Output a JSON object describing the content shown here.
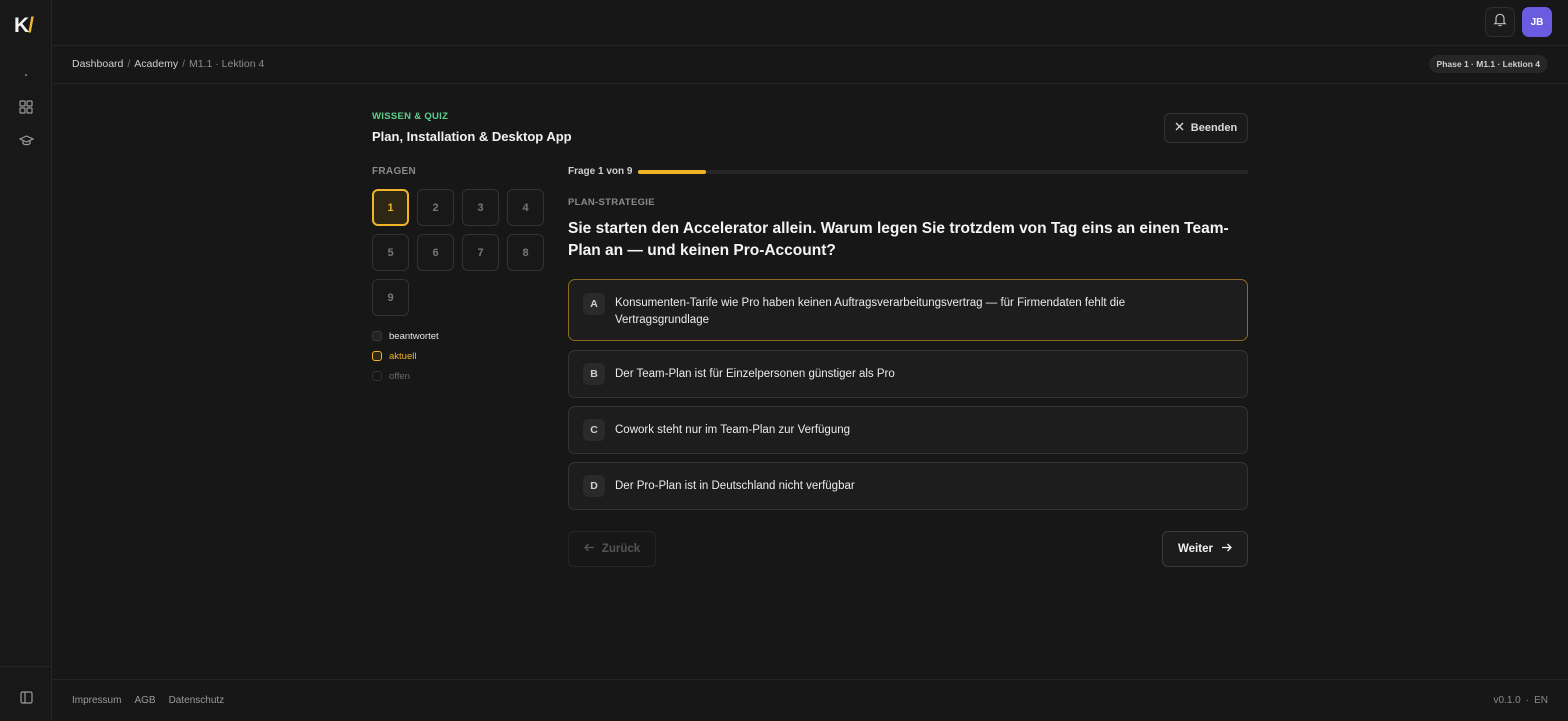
{
  "brand": {
    "logo_k": "K",
    "logo_slash": "/"
  },
  "sidebar": {
    "items": [
      {
        "icon": "dashboard-grid-icon"
      },
      {
        "icon": "graduation-cap-icon"
      }
    ],
    "bottom_icon": "sidebar-toggle-icon"
  },
  "header": {
    "avatar_initials": "JB",
    "notification_icon": "bell-icon"
  },
  "breadcrumb": {
    "items": [
      "Dashboard",
      "Academy",
      "M1.1 · Lektion 4"
    ],
    "separator": "/"
  },
  "phase_badge": "Phase 1 · M1.1 · Lektion 4",
  "quiz": {
    "eyebrow": "WISSEN & QUIZ",
    "title": "Plan, Installation & Desktop App",
    "end_label": "Beenden",
    "questions_heading": "FRAGEN",
    "question_numbers": [
      "1",
      "2",
      "3",
      "4",
      "5",
      "6",
      "7",
      "8",
      "9"
    ],
    "current_question": 1,
    "legend": {
      "answered": "beantwortet",
      "current": "aktuell",
      "open": "offen"
    },
    "progress_label": "Frage 1 von 9",
    "progress_fraction": 0.111,
    "category": "PLAN-STRATEGIE",
    "question": "Sie starten den Accelerator allein. Warum legen Sie trotzdem von Tag eins an einen Team-Plan an — und keinen Pro-Account?",
    "options": [
      {
        "letter": "A",
        "text": "Konsumenten-Tarife wie Pro haben keinen Auftragsverarbeitungsvertrag — für Firmendaten fehlt die Vertragsgrundlage"
      },
      {
        "letter": "B",
        "text": "Der Team-Plan ist für Einzelpersonen günstiger als Pro"
      },
      {
        "letter": "C",
        "text": "Cowork steht nur im Team-Plan zur Verfügung"
      },
      {
        "letter": "D",
        "text": "Der Pro-Plan ist in Deutschland nicht verfügbar"
      }
    ],
    "selected_option": "A",
    "back_label": "Zurück",
    "next_label": "Weiter"
  },
  "footer": {
    "links": [
      "Impressum",
      "AGB",
      "Datenschutz"
    ],
    "version": "v0.1.0",
    "dot": "·",
    "language": "EN"
  },
  "colors": {
    "accent": "#f0b429",
    "eyebrow": "#5fcf8b",
    "avatar": "#6a5ce0",
    "background": "#171717"
  }
}
